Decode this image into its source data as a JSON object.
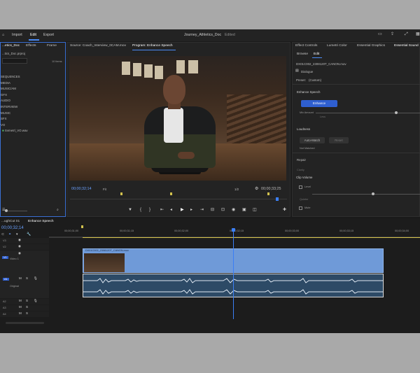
{
  "topbar": {
    "home_label": "⌂",
    "import": "Import",
    "edit": "Edit",
    "export": "Export",
    "project_title": "Journey_Athletics_Doc",
    "edited": "Edited"
  },
  "project_panel": {
    "tab_project": "...etics_Doc",
    "tab_effects": "Effects",
    "tab_frame": "Frame",
    "file": "...tics_Doc.prproj",
    "item_count": "10 Items",
    "bins": [
      "SEQUENCES",
      "MEDIA",
      "MUSIC/AM",
      "GFX",
      "AUDIO",
      "INTERVIEW",
      "MUSIC",
      "SFX",
      "VO"
    ],
    "subitem": "Svmetrl_VO.wav"
  },
  "monitor": {
    "source_tab": "Source: Coach_Interview_0CAM.mov",
    "program_tab": "Program: Enhance Speech",
    "timecode_left": "00;00;32;14",
    "fit": "Fit",
    "quality": "1/2",
    "timecode_right": "00;00;33;25"
  },
  "essential_sound": {
    "tabs": [
      "Effect Controls",
      "Lumetri Color",
      "Essential Graphics",
      "Essential Sound"
    ],
    "sub_tabs": [
      "Browse",
      "Edit"
    ],
    "clip_name": "DX01C002_2308120T_CANON.mov",
    "type": "Dialogue",
    "preset_label": "Preset:",
    "preset_value": "(Custom)",
    "enhance_speech": "Enhance Speech",
    "enhance_button": "Enhance",
    "mix_amount": "Mix Amount",
    "mix_less": "Less",
    "loudness": "Loudness",
    "auto_match": "Auto-Match",
    "reset": "Reset",
    "not_matched": "Not Matched",
    "repair": "Repair",
    "clarity": "Clarity",
    "clip_volume": "Clip Volume",
    "level": "Level",
    "quieter": "Quieter",
    "mute": "Mute"
  },
  "timeline": {
    "sequence_tab_left": "...ughCut 01",
    "sequence_tab": "Enhance Speech",
    "timecode": "00;00;32;14",
    "ruler": [
      "00;00;31;00",
      "00;00;31;15",
      "00;00;32;00",
      "00;00;32;15",
      "00;00;33;00",
      "00;00;33;15",
      "00;00;34;00"
    ],
    "tracks": {
      "v3": "V3",
      "v2": "V2",
      "v1": "V1",
      "video1": "Video 1",
      "a1": "A1",
      "original": "Original",
      "a2": "A2",
      "a3": "A3",
      "a4": "A4"
    },
    "clip_name": "DX01C002_2308120T_CANON.mov"
  },
  "colors": {
    "accent": "#3b7ff5",
    "clip_video": "#6f9ad8",
    "clip_audio": "#2d4a66",
    "enhance_button": "#2f5fd0"
  }
}
